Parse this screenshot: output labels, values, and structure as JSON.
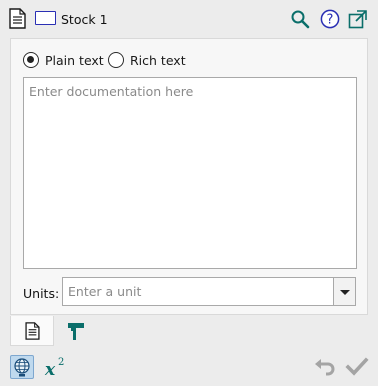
{
  "header": {
    "title": "Stock 1",
    "icons": {
      "doc": "document-icon",
      "type": "stock-icon",
      "search": "search-icon",
      "help": "help-icon",
      "popout": "popout-icon"
    },
    "colors": {
      "accent": "#2a2fb4",
      "teal": "#0a6e6a"
    }
  },
  "doc_mode": {
    "options": [
      "Plain text",
      "Rich text"
    ],
    "selected": "Plain text"
  },
  "documentation": {
    "value": "",
    "placeholder": "Enter documentation here"
  },
  "units": {
    "label": "Units:",
    "value": "",
    "placeholder": "Enter a unit"
  },
  "tabs": [
    {
      "icon": "document-icon",
      "active": true
    },
    {
      "icon": "paint-roller-icon",
      "active": false
    }
  ],
  "toolbar": {
    "left": [
      {
        "icon": "globe-icon",
        "active": true
      },
      {
        "icon": "equation-icon",
        "active": false
      }
    ],
    "right": [
      {
        "icon": "undo-icon",
        "enabled": false
      },
      {
        "icon": "check-icon",
        "enabled": false
      }
    ]
  }
}
